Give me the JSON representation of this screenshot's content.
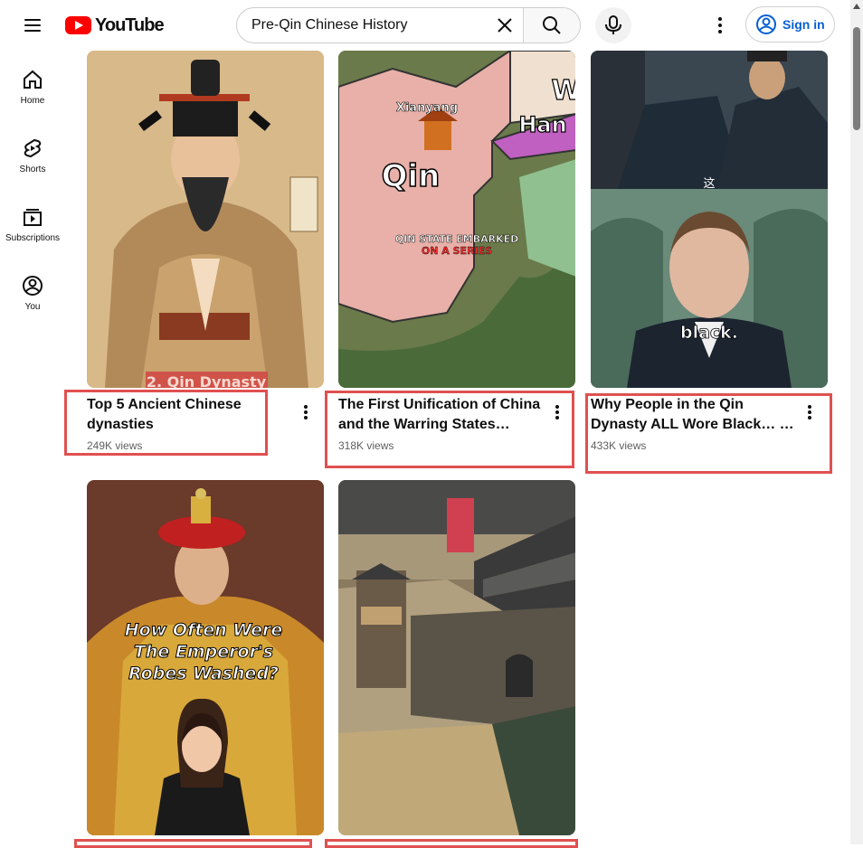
{
  "header": {
    "logo_text": "YouTube",
    "search": {
      "value": "Pre-Qin Chinese History",
      "placeholder": "Search"
    },
    "signin_label": "Sign in"
  },
  "sidebar": {
    "items": [
      {
        "label": "Home",
        "icon": "home-icon"
      },
      {
        "label": "Shorts",
        "icon": "shorts-icon"
      },
      {
        "label": "Subscriptions",
        "icon": "subscriptions-icon"
      },
      {
        "label": "You",
        "icon": "you-icon"
      }
    ]
  },
  "videos": [
    {
      "title": "Top 5 Ancient Chinese dynasties",
      "views": "249K views",
      "overlay": "2. Qin Dynasty"
    },
    {
      "title": "The First Unification of China and the Warring States Period…",
      "views": "318K views",
      "overlay_lines": [
        "QIN STATE EMBARKED",
        "ON A SERIES"
      ],
      "map_labels": [
        "Xianyang",
        "Qin",
        "Han",
        "W"
      ]
    },
    {
      "title": "Why People in the Qin Dynasty ALL Wore Black… …",
      "views": "433K views",
      "overlay_top": "这",
      "overlay": "black."
    },
    {
      "title": "",
      "views": "",
      "overlay_lines": [
        "How Often Were",
        "The Emperor's",
        "Robes Washed?"
      ]
    },
    {
      "title": "",
      "views": "",
      "overlay_lines": []
    }
  ],
  "colors": {
    "brand_red": "#ff0000",
    "link_blue": "#065fd4",
    "highlight": "#e05050"
  }
}
